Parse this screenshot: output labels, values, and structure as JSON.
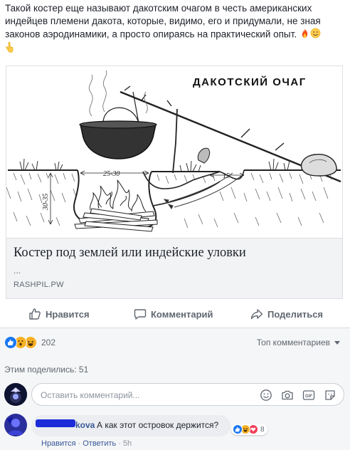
{
  "post": {
    "text_lines": [
      "Такой костер еще называют дакотским очагом в честь американских",
      "индейцев племени дакота, которые, видимо, его и придумали, не зная",
      "законов аэродинамики, а просто опираясь на практический опыт."
    ]
  },
  "link_card": {
    "image": {
      "title": "ДАКОТСКИЙ ОЧАГ",
      "dim_width": "25-30",
      "dim_depth": "30-35",
      "dim_tunnel": "15"
    },
    "title": "Костер под землей или индейские уловки",
    "description": "...",
    "domain": "RASHPIL.PW"
  },
  "actions": {
    "like": "Нравится",
    "comment": "Комментарий",
    "share": "Поделиться"
  },
  "reactions": {
    "count": "202",
    "top_comments": "Топ комментариев"
  },
  "shares": {
    "text": "Этим поделились: 51"
  },
  "compose": {
    "placeholder": "Оставить комментарий..."
  },
  "comment": {
    "author_suffix": "kova",
    "text": "А как этот островок держится?",
    "reaction_count": "8",
    "like": "Нравится",
    "reply": "Ответить",
    "time": "5h"
  },
  "colors": {
    "link": "#385898",
    "like_blue": "#1877f2",
    "love_red": "#f33e58",
    "haha_yellow": "#f7b125"
  }
}
